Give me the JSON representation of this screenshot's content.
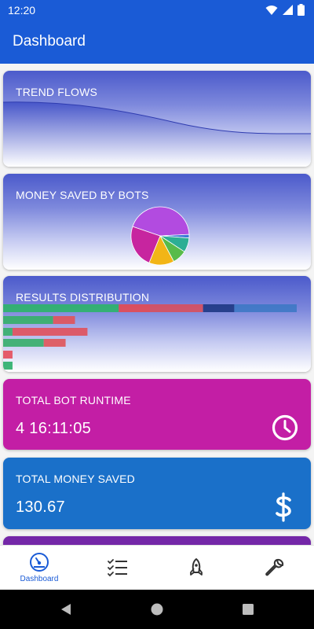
{
  "status": {
    "time": "12:20"
  },
  "app_bar": {
    "title": "Dashboard"
  },
  "cards": {
    "trend": {
      "title": "TREND FLOWS"
    },
    "money_saved": {
      "title": "MONEY SAVED BY BOTS",
      "slices": [
        {
          "value": 44,
          "color": "#b24be0"
        },
        {
          "value": 2,
          "color": "#3b78d6"
        },
        {
          "value": 8,
          "color": "#2cae94"
        },
        {
          "value": 8,
          "color": "#58bb4a"
        },
        {
          "value": 14,
          "color": "#f2b517"
        },
        {
          "value": 24,
          "color": "#c7259f"
        }
      ]
    },
    "results": {
      "title": "RESULTS DISTRIBUTION",
      "bars": [
        {
          "segments": [
            {
              "value": 37,
              "color": "#2eb36b"
            },
            {
              "value": 10,
              "color": "#e24b55"
            },
            {
              "value": 17,
              "color": "#d6505f"
            },
            {
              "value": 10,
              "color": "#1f3a86"
            },
            {
              "value": 20,
              "color": "#3f78c6"
            }
          ]
        },
        {
          "segments": [
            {
              "value": 16,
              "color": "#36b06a"
            },
            {
              "value": 7,
              "color": "#e0555c"
            }
          ]
        },
        {
          "segments": [
            {
              "value": 3,
              "color": "#39b06d"
            },
            {
              "value": 24,
              "color": "#e0525e"
            }
          ]
        },
        {
          "segments": [
            {
              "value": 13,
              "color": "#3aaf6e"
            },
            {
              "value": 7,
              "color": "#e0575c"
            }
          ]
        },
        {
          "segments": [
            {
              "value": 3,
              "color": "#e5505d"
            }
          ]
        },
        {
          "segments": [
            {
              "value": 3,
              "color": "#2fb06c"
            }
          ]
        }
      ]
    },
    "runtime": {
      "title": "TOTAL BOT RUNTIME",
      "value": "4 16:11:05",
      "icon": "clock-icon",
      "color": "#c31ea5"
    },
    "total_saved": {
      "title": "TOTAL MONEY SAVED",
      "value": "130.67",
      "icon": "dollar-icon",
      "color": "#1a70c9"
    }
  },
  "bottom_nav": {
    "items": [
      {
        "label": "Dashboard",
        "icon": "dashboard-gauge-icon",
        "active": true
      },
      {
        "label": "",
        "icon": "checklist-icon",
        "active": false
      },
      {
        "label": "",
        "icon": "rocket-icon",
        "active": false
      },
      {
        "label": "",
        "icon": "wrench-icon",
        "active": false
      }
    ]
  },
  "colors": {
    "primary": "#1a5bd6",
    "accent_pink": "#c31ea5",
    "accent_blue": "#1a70c9",
    "accent_purple": "#7427a8"
  }
}
